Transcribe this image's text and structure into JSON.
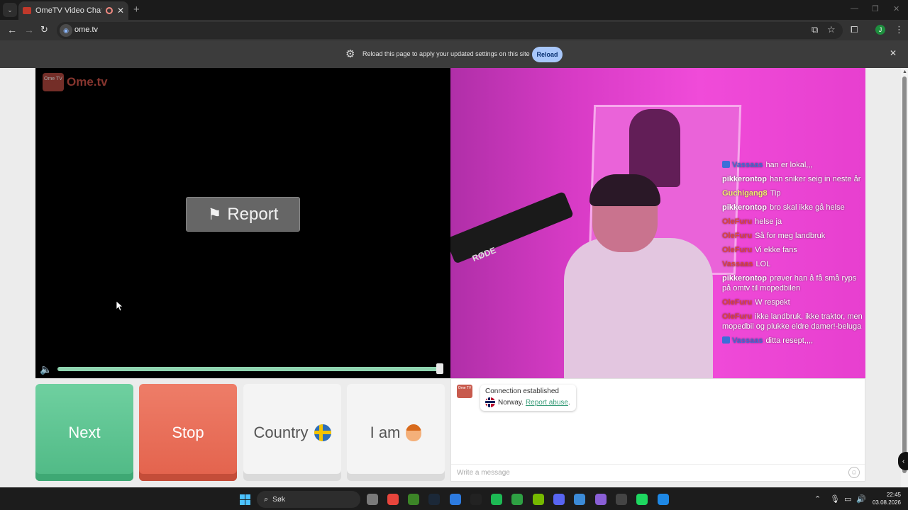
{
  "browser": {
    "tab_title": "OmeTV Video Chat — Ome",
    "url": "ome.tv",
    "infobar_text": "Reload this page to apply your updated settings on this site",
    "infobar_button": "Reload",
    "profile_initial": "J"
  },
  "local_video": {
    "logo_badge": "Ome TV",
    "logo_text": "Ome.tv",
    "report_label": "Report",
    "volume_level": 1.0
  },
  "remote_video": {
    "mic_brand": "RØDE",
    "chat": [
      {
        "user": "Vassaas",
        "text": "han er lokal,,,",
        "color": "#3b6fd8",
        "badge": true
      },
      {
        "user": "pikkerontop",
        "text": "han sniker seig in neste år",
        "color": "#ffffff",
        "badge": false
      },
      {
        "user": "Guchigang8",
        "text": "Tip",
        "color": "#f3f36b",
        "badge": false
      },
      {
        "user": "pikkerontop",
        "text": "bro skal ikke gå helse",
        "color": "#ffffff",
        "badge": false
      },
      {
        "user": "OleFuru",
        "text": "helse ja",
        "color": "#e0443a",
        "badge": false
      },
      {
        "user": "OleFuru",
        "text": "Så for meg landbruk",
        "color": "#e0443a",
        "badge": false
      },
      {
        "user": "OleFuru",
        "text": "Vi ekke fans",
        "color": "#e0443a",
        "badge": false
      },
      {
        "user": "Vassaas",
        "text": "LOL",
        "color": "#e0443a",
        "badge": false
      },
      {
        "user": "pikkerontop",
        "text": "prøver han å få små ryps på omtv til mopedbilen",
        "color": "#ffffff",
        "badge": false
      },
      {
        "user": "OleFuru",
        "text": "W respekt",
        "color": "#e0443a",
        "badge": false
      },
      {
        "user": "OleFuru",
        "text": "ikke landbruk, ikke traktor, men mopedbil og plukke eldre damer!-beluga",
        "color": "#e0443a",
        "badge": false
      },
      {
        "user": "Vassaas",
        "text": "ditta resept,,,,",
        "color": "#3b6fd8",
        "badge": true
      }
    ]
  },
  "buttons": {
    "next": "Next",
    "stop": "Stop",
    "country": "Country",
    "i_am": "I am"
  },
  "chat_panel": {
    "logo": "Ome TV",
    "status": "Connection established",
    "country": "Norway.",
    "report_link": "Report abuse",
    "input_placeholder": "Write a message"
  },
  "taskbar": {
    "search_label": "Søk",
    "time": "22:45",
    "date": "03.08.2026",
    "apps": [
      {
        "name": "file-explorer",
        "color": "#7a7a7a"
      },
      {
        "name": "chrome",
        "color": "#e8453c"
      },
      {
        "name": "minecraft",
        "color": "#3c8527"
      },
      {
        "name": "steam",
        "color": "#1b2838"
      },
      {
        "name": "app-blue",
        "color": "#2d7be0"
      },
      {
        "name": "capcut",
        "color": "#222222"
      },
      {
        "name": "app-green-h",
        "color": "#1db954"
      },
      {
        "name": "app-green-box",
        "color": "#2ea043"
      },
      {
        "name": "nvidia",
        "color": "#76b900"
      },
      {
        "name": "discord",
        "color": "#5865f2"
      },
      {
        "name": "photos",
        "color": "#3c8bd8"
      },
      {
        "name": "browser-app",
        "color": "#8a5fd6"
      },
      {
        "name": "obs",
        "color": "#444444"
      },
      {
        "name": "spotify",
        "color": "#1ed760"
      },
      {
        "name": "app-blue2",
        "color": "#1e88e5"
      }
    ]
  }
}
